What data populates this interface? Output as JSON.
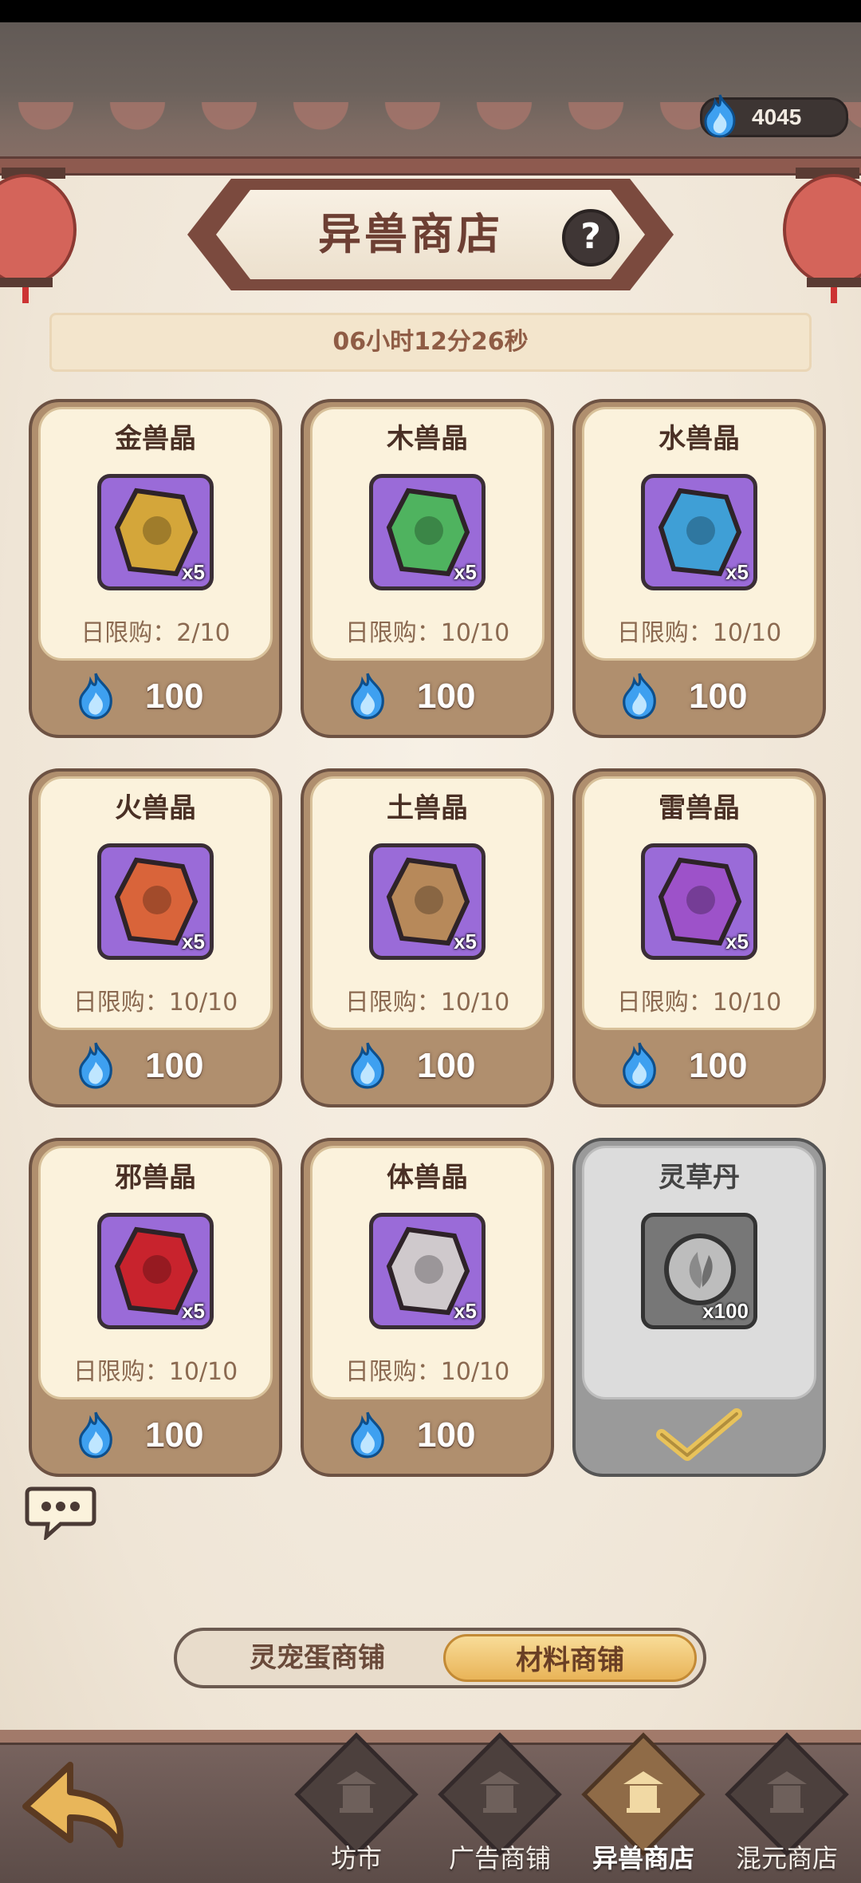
{
  "header": {
    "currency_value": "4045"
  },
  "title": {
    "text": "异兽商店",
    "help": "?"
  },
  "timer": "06小时12分26秒",
  "items": [
    {
      "name": "金兽晶",
      "qty": "x5",
      "limit": "日限购：2/10",
      "price": "100",
      "gem_color": "#d4a63a"
    },
    {
      "name": "木兽晶",
      "qty": "x5",
      "limit": "日限购：10/10",
      "price": "100",
      "gem_color": "#4fb35f"
    },
    {
      "name": "水兽晶",
      "qty": "x5",
      "limit": "日限购：10/10",
      "price": "100",
      "gem_color": "#3f9fd6"
    },
    {
      "name": "火兽晶",
      "qty": "x5",
      "limit": "日限购：10/10",
      "price": "100",
      "gem_color": "#d9643a"
    },
    {
      "name": "土兽晶",
      "qty": "x5",
      "limit": "日限购：10/10",
      "price": "100",
      "gem_color": "#b7895a"
    },
    {
      "name": "雷兽晶",
      "qty": "x5",
      "limit": "日限购：10/10",
      "price": "100",
      "gem_color": "#9d52c9"
    },
    {
      "name": "邪兽晶",
      "qty": "x5",
      "limit": "日限购：10/10",
      "price": "100",
      "gem_color": "#c8232d"
    },
    {
      "name": "体兽晶",
      "qty": "x5",
      "limit": "日限购：10/10",
      "price": "100",
      "gem_color": "#cfc9cc"
    },
    {
      "name": "灵草丹",
      "qty": "x100",
      "status": "sold-out"
    }
  ],
  "segment_tabs": {
    "left": "灵宠蛋商铺",
    "right": "材料商铺",
    "selected": "材料商铺"
  },
  "bottom_nav": [
    {
      "label": "坊市",
      "active": false
    },
    {
      "label": "广告商铺",
      "active": false
    },
    {
      "label": "异兽商店",
      "active": true
    },
    {
      "label": "混元商店",
      "active": false
    }
  ],
  "colors": {
    "accent": "#e9b458",
    "brand_text": "#6d3f33",
    "card_bg": "#fbf2dc",
    "spirit_flame": "#4aa3e8"
  }
}
